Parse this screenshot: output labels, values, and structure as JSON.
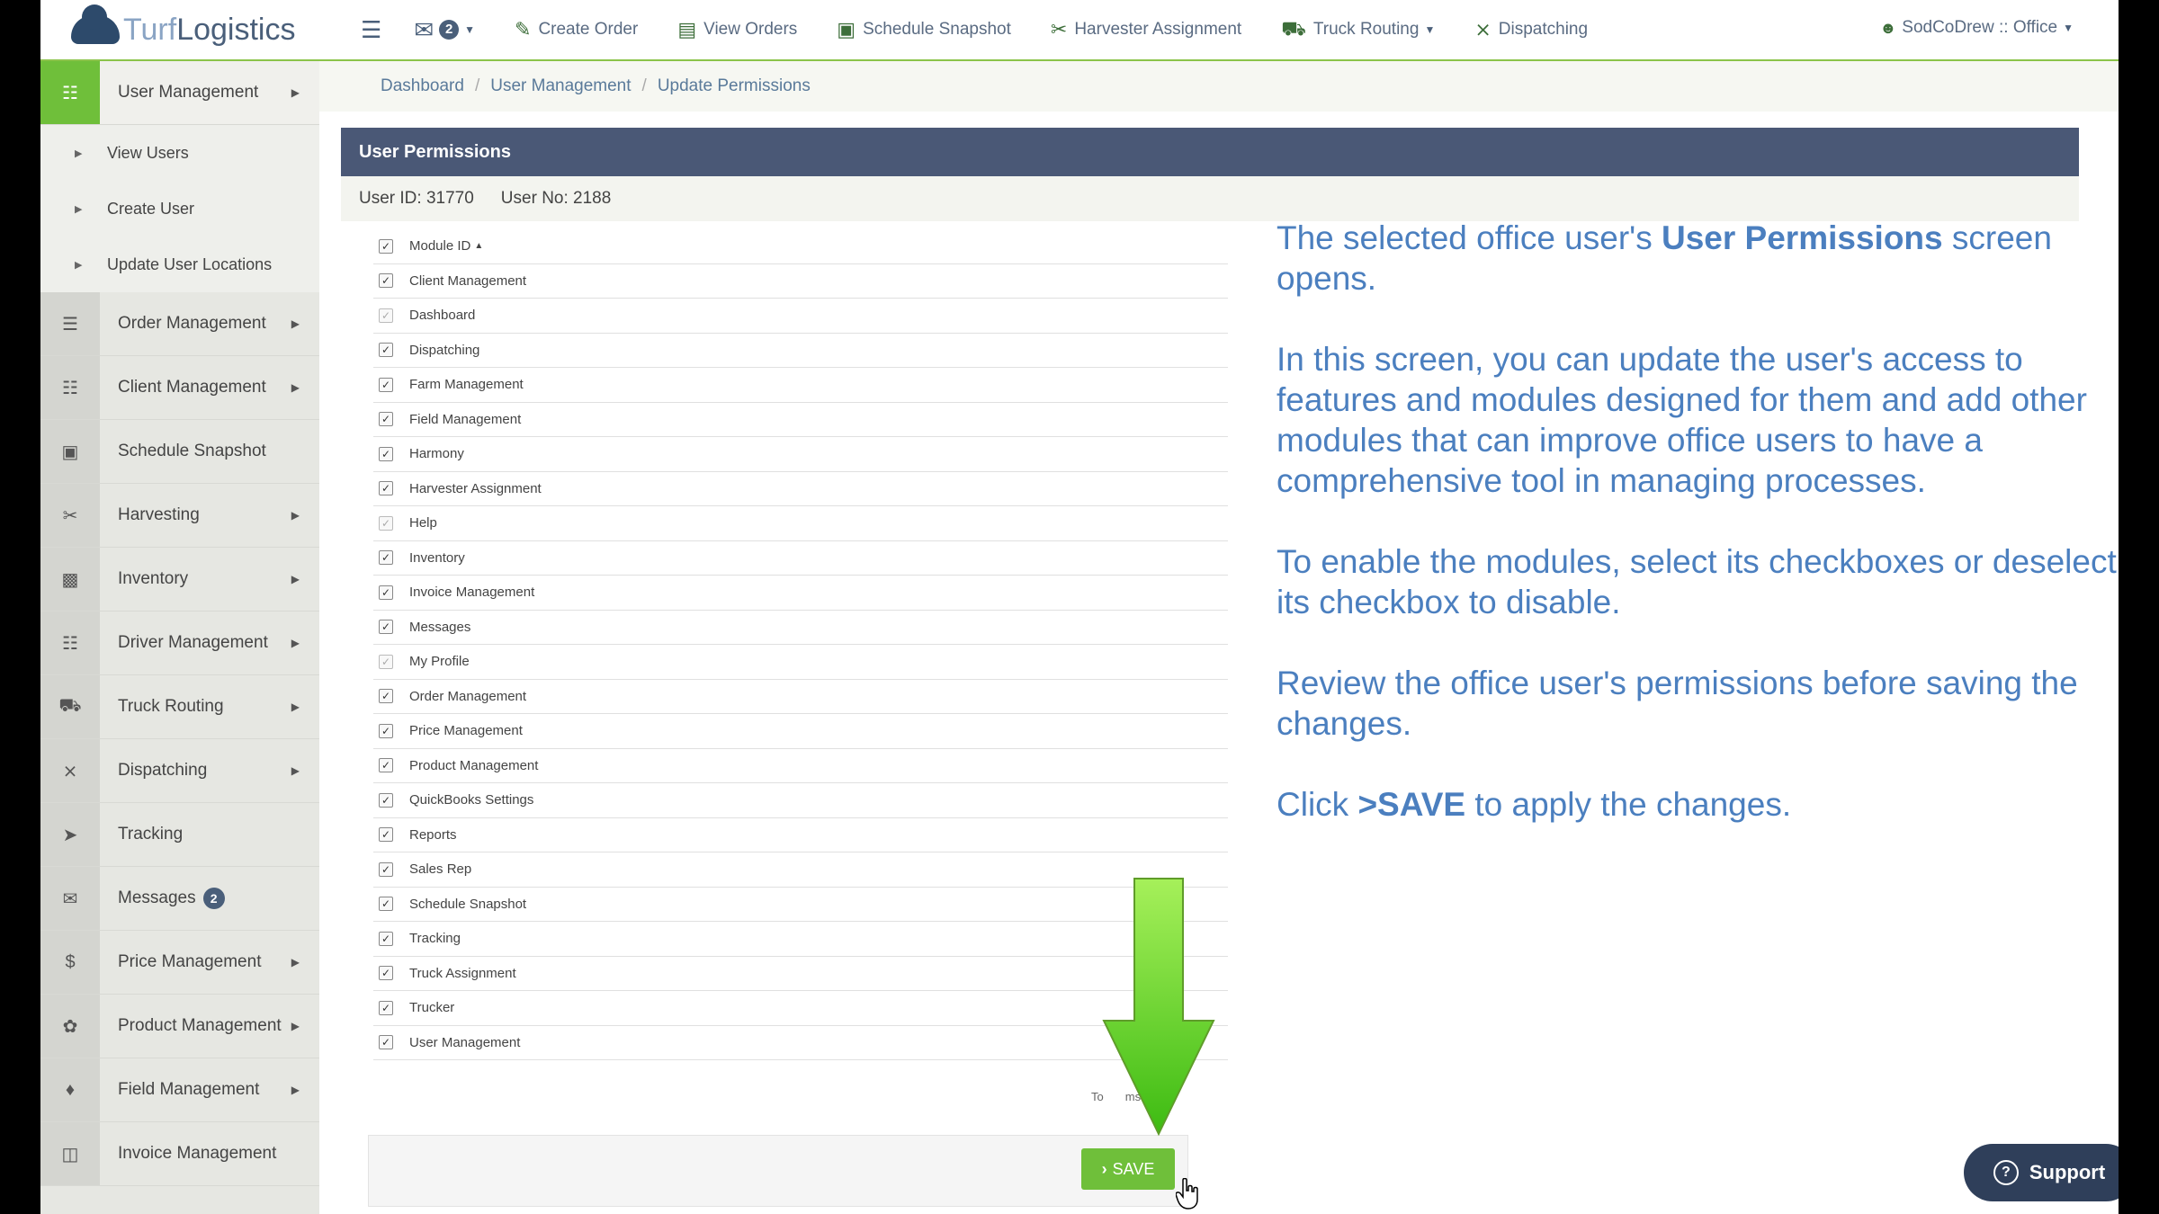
{
  "brand": {
    "name_part1": "Turf",
    "name_part2": "Logistics"
  },
  "topnav": {
    "mail_count": "2",
    "items": [
      {
        "label": "Create Order",
        "icon": "edit-icon"
      },
      {
        "label": "View Orders",
        "icon": "list-icon"
      },
      {
        "label": "Schedule Snapshot",
        "icon": "camera-icon"
      },
      {
        "label": "Harvester Assignment",
        "icon": "scissors-icon"
      },
      {
        "label": "Truck Routing",
        "icon": "truck-icon"
      },
      {
        "label": "Dispatching",
        "icon": "arrows-icon"
      }
    ],
    "user_label": "SodCoDrew :: Office"
  },
  "sidebar": {
    "items": [
      {
        "label": "User Management"
      },
      {
        "label": "Order Management"
      },
      {
        "label": "Client Management"
      },
      {
        "label": "Schedule Snapshot"
      },
      {
        "label": "Harvesting"
      },
      {
        "label": "Inventory"
      },
      {
        "label": "Driver Management"
      },
      {
        "label": "Truck Routing"
      },
      {
        "label": "Dispatching"
      },
      {
        "label": "Tracking"
      },
      {
        "label": "Messages",
        "badge": "2"
      },
      {
        "label": "Price Management"
      },
      {
        "label": "Product Management"
      },
      {
        "label": "Field Management"
      },
      {
        "label": "Invoice Management"
      }
    ],
    "subitems": [
      "View Users",
      "Create User",
      "Update User Locations"
    ]
  },
  "breadcrumb": [
    "Dashboard",
    "User Management",
    "Update Permissions"
  ],
  "panel": {
    "title": "User Permissions",
    "user_id": "User ID: 31770",
    "user_no": "User No: 2188",
    "column_header": "Module ID",
    "modules": [
      "Client Management",
      "Dashboard",
      "Dispatching",
      "Farm Management",
      "Field Management",
      "Harmony",
      "Harvester Assignment",
      "Help",
      "Inventory",
      "Invoice Management",
      "Messages",
      "My Profile",
      "Order Management",
      "Price Management",
      "Product Management",
      "QuickBooks Settings",
      "Reports",
      "Sales Rep",
      "Schedule Snapshot",
      "Tracking",
      "Truck Assignment",
      "Trucker",
      "User Management"
    ],
    "total_fragment_left": "To",
    "total_fragment_right": "ms.",
    "save_label": "SAVE"
  },
  "instructions": {
    "p1_a": "The selected office user's ",
    "p1_b": "User Permissions",
    "p1_c": " screen opens.",
    "p2": "In this screen, you can update the user's access to features and modules designed for them and add other modules that can improve office users to have a comprehensive tool in managing processes.",
    "p3": "To enable the modules, select its checkboxes or deselect its checkbox to disable.",
    "p4": "Review the office user's permissions before saving the changes.",
    "p5_a": "Click ",
    "p5_b": ">SAVE",
    "p5_c": " to apply the changes."
  },
  "support_label": "Support"
}
